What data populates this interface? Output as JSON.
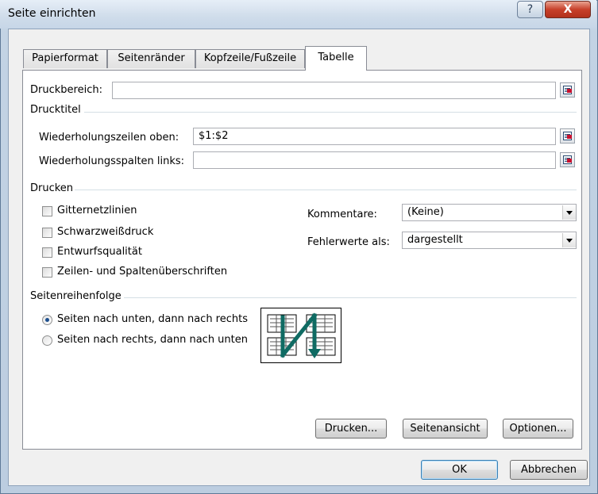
{
  "window": {
    "title": "Seite einrichten",
    "help_glyph": "?",
    "close_glyph": "X"
  },
  "tabs": [
    {
      "label": "Papierformat",
      "active": false
    },
    {
      "label": "Seitenränder",
      "active": false
    },
    {
      "label": "Kopfzeile/Fußzeile",
      "active": false
    },
    {
      "label": "Tabelle",
      "active": true
    }
  ],
  "print_area": {
    "label": "Druckbereich:",
    "value": ""
  },
  "print_titles": {
    "heading": "Drucktitel",
    "rows_label": "Wiederholungszeilen oben:",
    "rows_value": "$1:$2",
    "cols_label": "Wiederholungsspalten links:",
    "cols_value": ""
  },
  "print": {
    "heading": "Drucken",
    "checkboxes": [
      {
        "label": "Gitternetzlinien",
        "checked": false
      },
      {
        "label": "Schwarzweißdruck",
        "checked": false
      },
      {
        "label": "Entwurfsqualität",
        "checked": false
      },
      {
        "label": "Zeilen- und Spaltenüberschriften",
        "checked": false
      }
    ],
    "comments_label": "Kommentare:",
    "comments_value": "(Keine)",
    "errors_label": "Fehlerwerte als:",
    "errors_value": "dargestellt"
  },
  "page_order": {
    "heading": "Seitenreihenfolge",
    "option_down": "Seiten nach unten, dann nach rechts",
    "option_over": "Seiten nach rechts, dann nach unten",
    "selected": "down"
  },
  "buttons": {
    "print": "Drucken...",
    "preview": "Seitenansicht",
    "options": "Optionen...",
    "ok": "OK",
    "cancel": "Abbrechen"
  },
  "icons": {
    "range_picker": "range-picker-icon",
    "page_order": "page-order-icon"
  },
  "colors": {
    "title_bar": "#cfdcea",
    "close_button": "#c7402a",
    "accent": "#1c4f8e"
  }
}
